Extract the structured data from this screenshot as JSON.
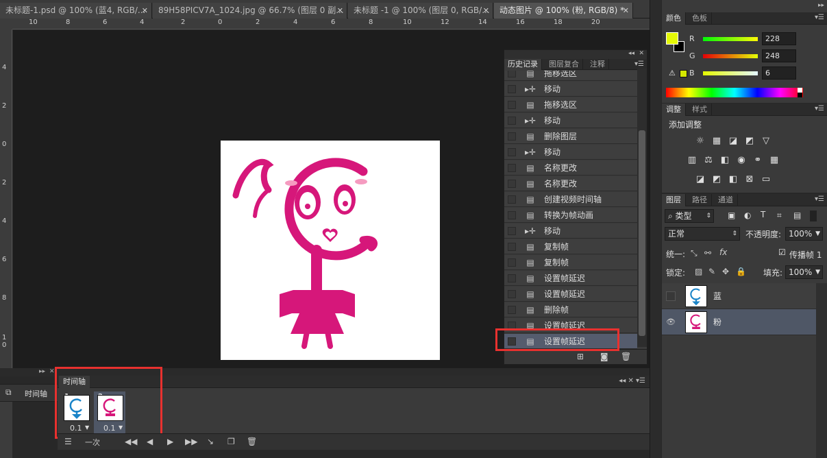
{
  "tabs": [
    {
      "label": "未标题-1.psd @ 100% (蓝4, RGB/..."
    },
    {
      "label": "89H58PICV7A_1024.jpg @ 66.7% (图层 0 副..."
    },
    {
      "label": "未标题 -1 @ 100% (图层 0, RGB/..."
    },
    {
      "label": "动态图片 @ 100% (粉, RGB/8) *"
    }
  ],
  "ruler_top": [
    "10",
    "8",
    "6",
    "4",
    "2",
    "0",
    "2",
    "4",
    "6",
    "8",
    "10",
    "12",
    "14",
    "16",
    "18",
    "20"
  ],
  "ruler_left": [
    "4",
    "2",
    "0",
    "2",
    "4",
    "6",
    "8",
    "1\n0"
  ],
  "history": {
    "tabs": [
      "历史记录",
      "图层复合",
      "注释"
    ],
    "items": [
      {
        "label": "拖移选区",
        "icon": "doc-icon"
      },
      {
        "label": "移动",
        "icon": "move-icon"
      },
      {
        "label": "拖移选区",
        "icon": "doc-icon"
      },
      {
        "label": "移动",
        "icon": "move-icon"
      },
      {
        "label": "删除图层",
        "icon": "doc-icon"
      },
      {
        "label": "移动",
        "icon": "move-icon"
      },
      {
        "label": "名称更改",
        "icon": "doc-icon"
      },
      {
        "label": "名称更改",
        "icon": "doc-icon"
      },
      {
        "label": "创建视频时间轴",
        "icon": "doc-icon"
      },
      {
        "label": "转换为帧动画",
        "icon": "doc-icon"
      },
      {
        "label": "移动",
        "icon": "move-icon"
      },
      {
        "label": "复制帧",
        "icon": "doc-icon"
      },
      {
        "label": "复制帧",
        "icon": "doc-icon"
      },
      {
        "label": "设置帧延迟",
        "icon": "doc-icon"
      },
      {
        "label": "设置帧延迟",
        "icon": "doc-icon"
      },
      {
        "label": "删除帧",
        "icon": "doc-icon"
      },
      {
        "label": "设置帧延迟",
        "icon": "doc-icon"
      },
      {
        "label": "设置帧延迟",
        "icon": "doc-icon"
      }
    ]
  },
  "timeline": {
    "tab": "时间轴",
    "side_label": "时间轴",
    "frames": [
      {
        "num": "1",
        "delay": "0.1"
      },
      {
        "num": "2",
        "delay": "0.1"
      }
    ],
    "loop": "一次"
  },
  "color": {
    "tabs": [
      "颜色",
      "色板"
    ],
    "r": "228",
    "g": "248",
    "b": "6",
    "foreground": "#e4f806"
  },
  "adjust": {
    "tabs": [
      "调整",
      "样式"
    ],
    "title": "添加调整"
  },
  "layers": {
    "tabs": [
      "图层",
      "路径",
      "通道"
    ],
    "filter": "类型",
    "blend": "正常",
    "opacity_label": "不透明度:",
    "opacity": "100%",
    "unify_label": "统一:",
    "propagate_label": "传播帧 1",
    "lock_label": "锁定:",
    "fill_label": "填充:",
    "fill": "100%",
    "items": [
      {
        "name": "蓝",
        "visible": false
      },
      {
        "name": "粉",
        "visible": true
      }
    ]
  },
  "colors": {
    "pink": "#d6177a",
    "blue": "#1a84c8",
    "selection": "#555c6d",
    "highlight": "#e8312f"
  }
}
